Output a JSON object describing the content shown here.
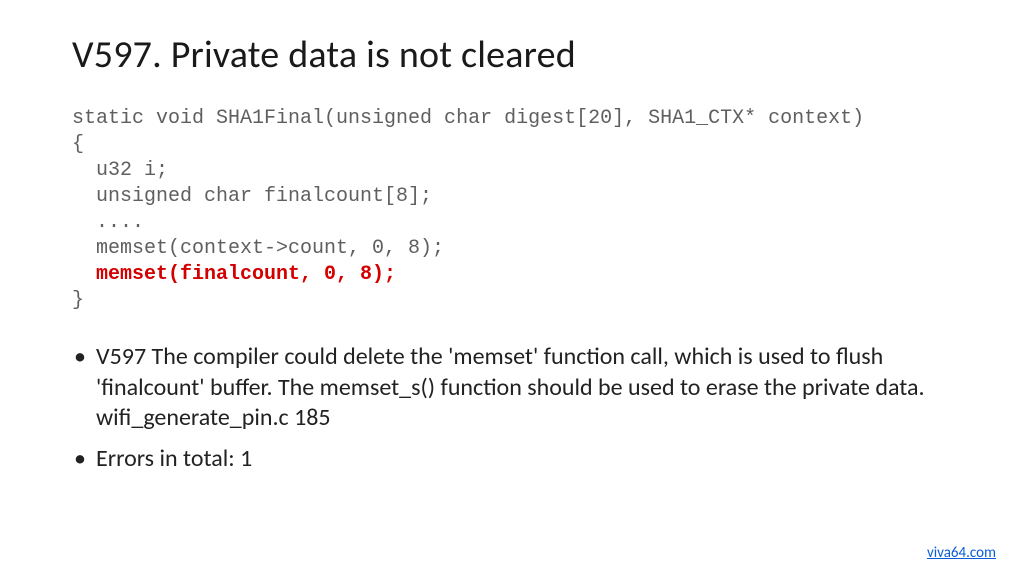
{
  "title": "V597. Private data is not cleared",
  "code": {
    "l1": "static void SHA1Final(unsigned char digest[20], SHA1_CTX* context)",
    "l2": "{",
    "l3": "  u32 i;",
    "l4": "  unsigned char finalcount[8];",
    "l5": "  ....",
    "l6": "  memset(context->count, 0, 8);",
    "l7": "  memset(finalcount, 0, 8);",
    "l8": "}"
  },
  "bullets": [
    "V597 The compiler could delete the 'memset' function call, which is used to flush 'finalcount' buffer. The memset_s() function should be used to erase the private data. wifi_generate_pin.c 185",
    "Errors in total: 1"
  ],
  "footer_link": "viva64.com"
}
